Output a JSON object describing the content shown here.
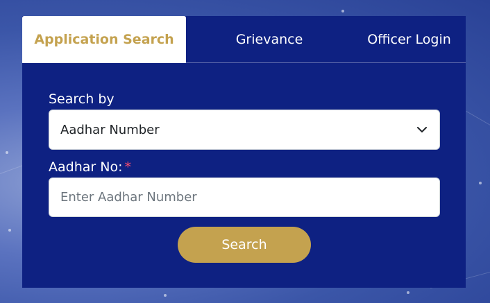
{
  "tabs": {
    "application_search": "Application Search",
    "grievance": "Grievance",
    "officer_login": "Officer Login"
  },
  "form": {
    "search_by_label": "Search by",
    "search_by_selected": "Aadhar Number",
    "aadhar_label": "Aadhar No:",
    "required_marker": "*",
    "aadhar_placeholder": "Enter Aadhar Number",
    "search_button": "Search"
  },
  "colors": {
    "panel_bg": "#0e2182",
    "accent_gold": "#c4a24f",
    "required_red": "#ff4d6d"
  },
  "icons": {
    "select_chevron": "chevron-down-icon"
  }
}
